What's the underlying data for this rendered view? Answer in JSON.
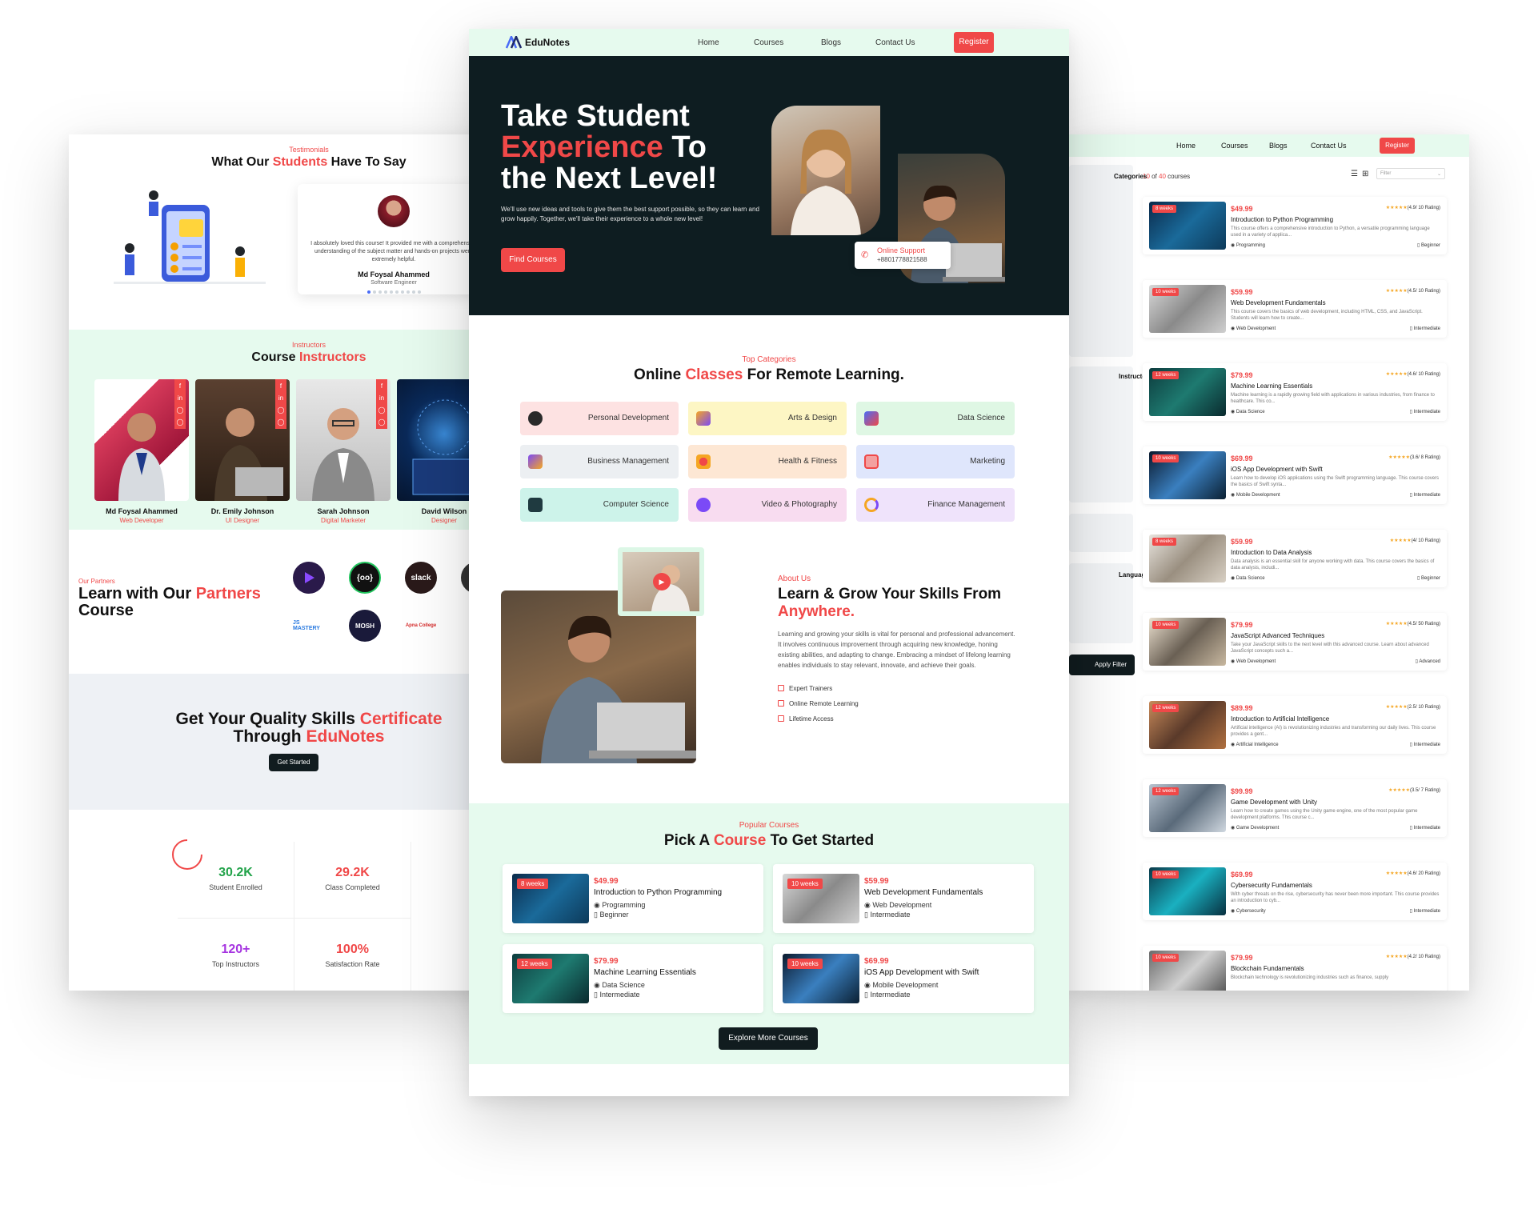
{
  "colors": {
    "accent": "#f04848",
    "dark": "#0e1d21",
    "mint": "#e6faee"
  },
  "left": {
    "testimonials": {
      "eyebrow": "Testimonials",
      "title_a": "What Our ",
      "title_b": "Students",
      "title_c": " Have To Say",
      "quote": "I absolutely loved this course! It provided me with a comprehensive understanding of the subject matter and hands-on projects were extremely helpful.",
      "name": "Md Foysal Ahammed",
      "role": "Software Engineer"
    },
    "instructors": {
      "eyebrow": "Instructors",
      "title_a": "Course ",
      "title_b": "Instructors",
      "items": [
        {
          "name": "Md Foysal Ahammed",
          "role": "Web Developer"
        },
        {
          "name": "Dr. Emily Johnson",
          "role": "UI Designer"
        },
        {
          "name": "Sarah Johnson",
          "role": "Digital Marketer"
        },
        {
          "name": "David Wilson",
          "role": "Designer"
        }
      ]
    },
    "partners": {
      "eyebrow": "Our Partners",
      "title_a": "Learn with Our ",
      "title_b": "Partners",
      "title_c": "Course",
      "logos": [
        "slack",
        "JS MASTERY",
        "MOSH",
        "Apna College"
      ]
    },
    "cta": {
      "title_a": "Get Your Quality Skills ",
      "title_b": "Certificate",
      "title_c": "Through ",
      "title_d": "EduNotes",
      "button": "Get Started"
    },
    "stats": [
      {
        "num": "30.2K",
        "label": "Student Enrolled",
        "color": "#22a34a"
      },
      {
        "num": "29.2K",
        "label": "Class Completed",
        "color": "#f04848"
      },
      {
        "num": "120+",
        "label": "Top Instructors",
        "color": "#a533e0"
      },
      {
        "num": "100%",
        "label": "Satisfaction Rate",
        "color": "#f04848"
      }
    ]
  },
  "center": {
    "nav": {
      "brand": "EduNotes",
      "links": [
        "Home",
        "Courses",
        "Blogs",
        "Contact Us"
      ],
      "register": "Register"
    },
    "hero": {
      "line1": "Take Student",
      "line2a": "Experience",
      "line2b": " To",
      "line3": "the Next Level!",
      "desc": "We'll use new ideas and tools to give them the best support possible, so they can learn and grow happily. Together, we'll take their experience to a whole new level!",
      "button": "Find Courses",
      "support_label": "Online Support",
      "support_phone": "+8801778821588"
    },
    "categories": {
      "eyebrow": "Top Categories",
      "title_a": "Online ",
      "title_b": "Classes",
      "title_c": " For Remote Learning.",
      "items": [
        "Personal Development",
        "Arts & Design",
        "Data Science",
        "Business Management",
        "Health & Fitness",
        "Marketing",
        "Computer Science",
        "Video & Photography",
        "Finance Management"
      ]
    },
    "about": {
      "eyebrow": "About Us",
      "title_a": "Learn & Grow Your Skills From",
      "title_b": "Anywhere.",
      "desc": "Learning and growing your skills is vital for personal and professional advancement. It involves continuous improvement through acquiring new knowledge, honing existing abilities, and adapting to change. Embracing a mindset of lifelong learning enables individuals to stay relevant, innovate, and achieve their goals.",
      "points": [
        "Expert Trainers",
        "Online Remote Learning",
        "Lifetime Access"
      ]
    },
    "popular": {
      "eyebrow": "Popular Courses",
      "title_a": "Pick A ",
      "title_b": "Course",
      "title_c": " To Get Started",
      "button": "Explore More Courses",
      "items": [
        {
          "weeks": "8 weeks",
          "price": "$49.99",
          "title": "Introduction to Python Programming",
          "cat": "Programming",
          "level": "Beginner"
        },
        {
          "weeks": "10 weeks",
          "price": "$59.99",
          "title": "Web Development Fundamentals",
          "cat": "Web Development",
          "level": "Intermediate"
        },
        {
          "weeks": "12 weeks",
          "price": "$79.99",
          "title": "Machine Learning Essentials",
          "cat": "Data Science",
          "level": "Intermediate"
        },
        {
          "weeks": "10 weeks",
          "price": "$69.99",
          "title": "iOS App Development with Swift",
          "cat": "Mobile Development",
          "level": "Intermediate"
        }
      ]
    }
  },
  "right": {
    "nav": {
      "links": [
        "Home",
        "Courses",
        "Blogs",
        "Contact Us"
      ],
      "register": "Register"
    },
    "count_a": "10",
    "count_b": " of ",
    "count_c": "40",
    "count_d": " courses",
    "sort": "Filter",
    "filter_button": "Apply Filter",
    "side_labels": [
      "Categories",
      "Instructor",
      "Language"
    ],
    "courses": [
      {
        "weeks": "8 weeks",
        "price": "$49.99",
        "rating": "(4.9/ 10 Rating)",
        "title": "Introduction to Python Programming",
        "desc": "This course offers a comprehensive introduction to Python, a versatile programming language used in a variety of applica...",
        "cat": "Programming",
        "level": "Beginner"
      },
      {
        "weeks": "10 weeks",
        "price": "$59.99",
        "rating": "(4.5/ 10 Rating)",
        "title": "Web Development Fundamentals",
        "desc": "This course covers the basics of web development, including HTML, CSS, and JavaScript. Students will learn how to create...",
        "cat": "Web Development",
        "level": "Intermediate"
      },
      {
        "weeks": "12 weeks",
        "price": "$79.99",
        "rating": "(4.6/ 10 Rating)",
        "title": "Machine Learning Essentials",
        "desc": "Machine learning is a rapidly growing field with applications in various industries, from finance to healthcare. This co...",
        "cat": "Data Science",
        "level": "Intermediate"
      },
      {
        "weeks": "10 weeks",
        "price": "$69.99",
        "rating": "(3.6/ 8 Rating)",
        "title": "iOS App Development with Swift",
        "desc": "Learn how to develop iOS applications using the Swift programming language. This course covers the basics of Swift synta...",
        "cat": "Mobile Development",
        "level": "Intermediate"
      },
      {
        "weeks": "8 weeks",
        "price": "$59.99",
        "rating": "(4/ 10 Rating)",
        "title": "Introduction to Data Analysis",
        "desc": "Data analysis is an essential skill for anyone working with data. This course covers the basics of data analysis, includi...",
        "cat": "Data Science",
        "level": "Beginner"
      },
      {
        "weeks": "10 weeks",
        "price": "$79.99",
        "rating": "(4.5/ 50 Rating)",
        "title": "JavaScript Advanced Techniques",
        "desc": "Take your JavaScript skills to the next level with this advanced course. Learn about advanced JavaScript concepts such a...",
        "cat": "Web Development",
        "level": "Advanced"
      },
      {
        "weeks": "12 weeks",
        "price": "$89.99",
        "rating": "(2.5/ 10 Rating)",
        "title": "Introduction to Artificial Intelligence",
        "desc": "Artificial intelligence (AI) is revolutionizing industries and transforming our daily lives. This course provides a gent...",
        "cat": "Artificial Intelligence",
        "level": "Intermediate"
      },
      {
        "weeks": "12 weeks",
        "price": "$99.99",
        "rating": "(3.5/ 7 Rating)",
        "title": "Game Development with Unity",
        "desc": "Learn how to create games using the Unity game engine, one of the most popular game development platforms. This course c...",
        "cat": "Game Development",
        "level": "Intermediate"
      },
      {
        "weeks": "10 weeks",
        "price": "$69.99",
        "rating": "(4.6/ 20 Rating)",
        "title": "Cybersecurity Fundamentals",
        "desc": "With cyber threats on the rise, cybersecurity has never been more important. This course provides an introduction to cyb...",
        "cat": "Cybersecurity",
        "level": "Intermediate"
      },
      {
        "weeks": "10 weeks",
        "price": "$79.99",
        "rating": "(4.2/ 10 Rating)",
        "title": "Blockchain Fundamentals",
        "desc": "Blockchain technology is revolutionizing industries such as finance, supply",
        "cat": "",
        "level": ""
      }
    ]
  }
}
